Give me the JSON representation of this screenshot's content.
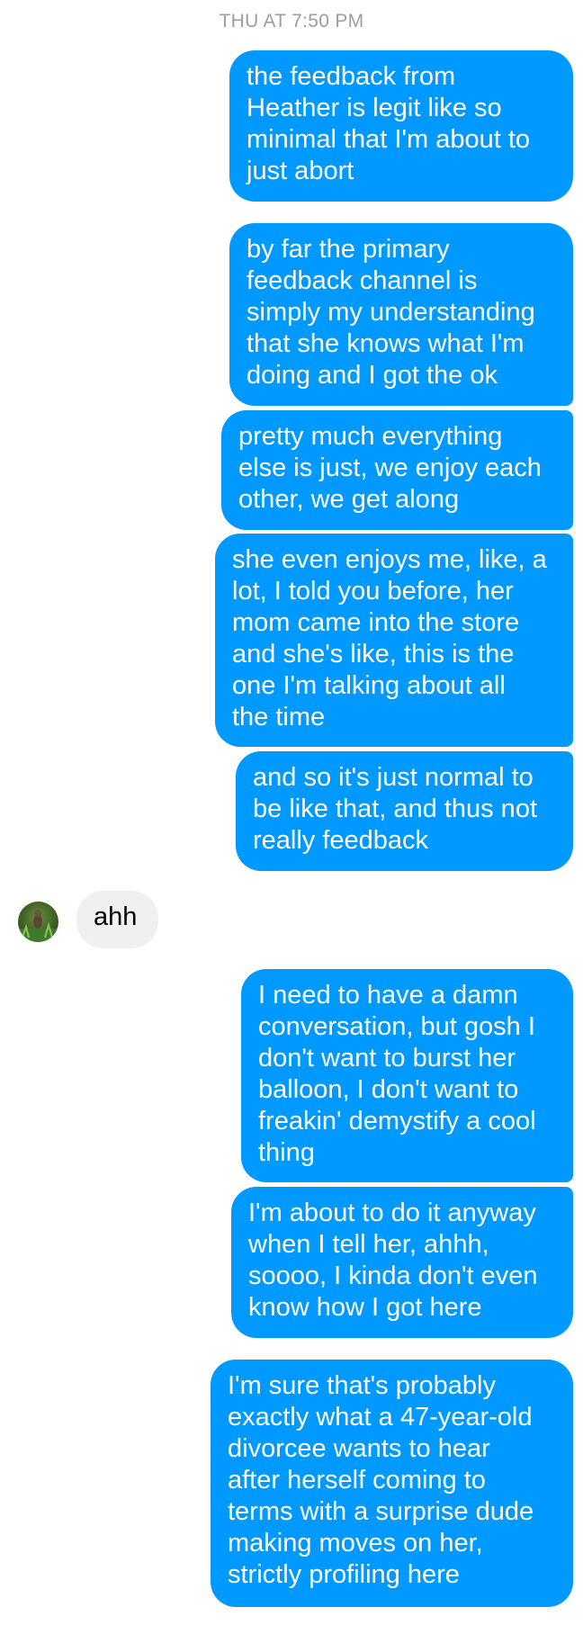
{
  "thread": {
    "timestamp": "THU AT 7:50 PM",
    "colors": {
      "outgoing_bubble": "#0099ff",
      "incoming_bubble": "#f0f0f0",
      "timestamp_text": "#9e9e9e"
    },
    "messages": [
      {
        "from": "me",
        "text": "the feedback from\nHeather is legit like so\nminimal that I'm about to\njust abort"
      },
      {
        "from": "me",
        "text": "by far the primary\nfeedback channel is\nsimply my understanding\nthat she knows what I'm\ndoing and I got the ok"
      },
      {
        "from": "me",
        "text": "pretty much everything\nelse is just, we enjoy each\nother, we get along"
      },
      {
        "from": "me",
        "text": "she even enjoys me, like, a\nlot, I told you before, her\nmom came into the store\nand she's like, this is the\none I'm talking about all\nthe time"
      },
      {
        "from": "me",
        "text": "and so it's just normal to\nbe like that, and thus not\nreally feedback"
      },
      {
        "from": "them",
        "text": "ahh",
        "avatar_icon": "profile-photo-icon"
      },
      {
        "from": "me",
        "text": "I need to have a damn\nconversation, but gosh I\ndon't want to burst her\nballoon, I don't want to\nfreakin' demystify a cool\nthing"
      },
      {
        "from": "me",
        "text": "I'm about to do it anyway\nwhen I tell her, ahhh,\nsoooo, I kinda don't even\nknow how I got here"
      },
      {
        "from": "me",
        "text": "I'm sure that's probably\nexactly what a 47-year-old\ndivorcee wants to hear\nafter herself coming to\nterms with a surprise dude\nmaking moves on her,\nstrictly profiling here"
      }
    ]
  }
}
